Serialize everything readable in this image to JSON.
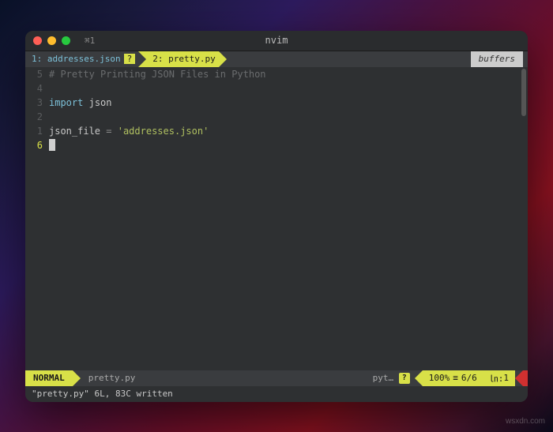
{
  "titlebar": {
    "tab_indicator": "⌘1",
    "title": "nvim"
  },
  "buffers": {
    "tabs": [
      {
        "index": "1:",
        "name": "addresses.json",
        "modified": "?"
      },
      {
        "index": "2:",
        "name": "pretty.py",
        "modified": ""
      }
    ],
    "label": "buffers"
  },
  "editor": {
    "gutter": [
      "5",
      "4",
      "3",
      "2",
      "1",
      "6"
    ],
    "lines": [
      {
        "type": "comment",
        "text": "# Pretty Printing JSON Files in Python"
      },
      {
        "type": "blank",
        "text": ""
      },
      {
        "type": "import",
        "kw": "import",
        "mod": "json"
      },
      {
        "type": "blank",
        "text": ""
      },
      {
        "type": "assign",
        "var": "json_file",
        "op": "=",
        "str": "'addresses.json'"
      },
      {
        "type": "cursor",
        "text": ""
      }
    ]
  },
  "statusline": {
    "mode": "NORMAL",
    "filename": "pretty.py",
    "filetype": "pyt…",
    "filetype_icon": "?",
    "percent": "100%",
    "line_total": "6/6",
    "col": "1"
  },
  "cmdline": {
    "message": "\"pretty.py\" 6L, 83C written"
  },
  "watermark": "wsxdn.com"
}
